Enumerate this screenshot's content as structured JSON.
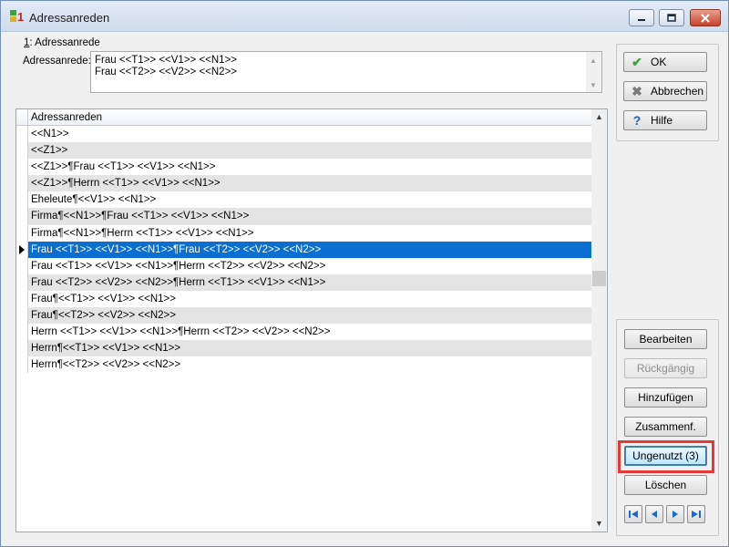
{
  "window": {
    "title": "Adressanreden",
    "title_icon": "app-logo-icon"
  },
  "group": {
    "number": "1",
    "label": ": Adressanrede",
    "field_label": "Adressanrede:",
    "value_lines": [
      "Frau <<T1>> <<V1>> <<N1>>",
      "Frau <<T2>> <<V2>> <<N2>>"
    ]
  },
  "grid": {
    "column_header": "Adressanreden",
    "selected_index": 7,
    "rows": [
      "<<N1>>",
      "<<Z1>>",
      "<<Z1>>¶Frau <<T1>> <<V1>> <<N1>>",
      "<<Z1>>¶Herrn <<T1>> <<V1>> <<N1>>",
      "Eheleute¶<<V1>> <<N1>>",
      "Firma¶<<N1>>¶Frau <<T1>> <<V1>> <<N1>>",
      "Firma¶<<N1>>¶Herrn <<T1>> <<V1>> <<N1>>",
      "Frau <<T1>> <<V1>> <<N1>>¶Frau <<T2>> <<V2>> <<N2>>",
      "Frau <<T1>> <<V1>> <<N1>>¶Herrn <<T2>> <<V2>> <<N2>>",
      "Frau <<T2>> <<V2>> <<N2>>¶Herrn <<T1>> <<V1>> <<N1>>",
      "Frau¶<<T1>> <<V1>> <<N1>>",
      "Frau¶<<T2>> <<V2>> <<N2>>",
      "Herrn <<T1>> <<V1>> <<N1>>¶Herrn <<T2>> <<V2>> <<N2>>",
      "Herrn¶<<T1>> <<V1>> <<N1>>",
      "Herrn¶<<T2>> <<V2>> <<N2>>"
    ]
  },
  "buttons": {
    "ok": "OK",
    "cancel": "Abbrechen",
    "help": "Hilfe",
    "edit": "Bearbeiten",
    "undo": "Rückgängig",
    "add": "Hinzufügen",
    "merge": "Zusammenf.",
    "unused": "Ungenutzt (3)",
    "delete": "Löschen"
  },
  "nav": {
    "first": "first-record-icon",
    "prev": "previous-record-icon",
    "next": "next-record-icon",
    "last": "last-record-icon"
  },
  "colors": {
    "selection": "#0a6fd1",
    "highlight": "#e53935",
    "ok_check": "#3aa63a",
    "cancel_x": "#7a7a7a",
    "help_q": "#2060c0"
  }
}
